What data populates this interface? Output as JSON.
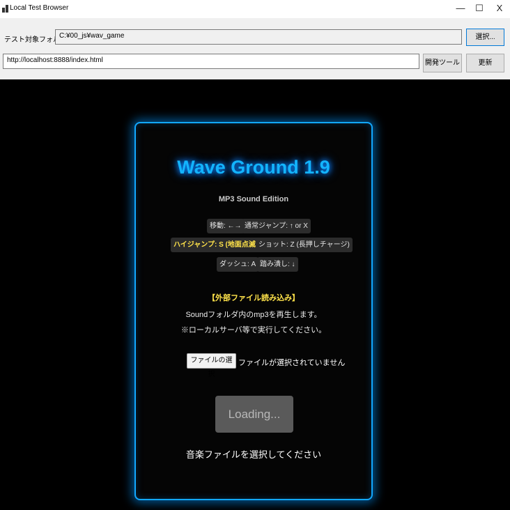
{
  "window": {
    "title": "Local Test Browser",
    "icon": "app-icon",
    "controls": {
      "minimize": "—",
      "maximize": "☐",
      "close": "X"
    }
  },
  "toolbar": {
    "folder_label": "テスト対象フォルダ:",
    "folder_value": "C:¥00_js¥wav_game",
    "select_button": "選択...",
    "url_value": "http://localhost:8888/index.html",
    "devtools_button": "開発ツール",
    "refresh_button": "更新"
  },
  "game": {
    "title": "Wave Ground 1.9",
    "subtitle": "MP3 Sound Edition",
    "controls": [
      {
        "text": "移動: ←→",
        "highlight": false
      },
      {
        "text": "通常ジャンプ: ↑ or X",
        "highlight": false
      },
      {
        "text": "ハイジャンプ: S (地面点滅時)",
        "highlight": true
      },
      {
        "text": "ショット: Z (長押しチャージ)",
        "highlight": false
      },
      {
        "text": "ダッシュ: A",
        "highlight": false
      },
      {
        "text": "踏み潰し: ↓",
        "highlight": false
      }
    ],
    "external": {
      "heading": "【外部ファイル読み込み】",
      "line1": "Soundフォルダ内のmp3を再生します。",
      "line2": "※ローカルサーバ等で実行してください。"
    },
    "file_input": {
      "button": "ファイルの選択",
      "status": "ファイルが選択されていません"
    },
    "start_button": "Loading...",
    "message": "音楽ファイルを選択してください"
  },
  "colors": {
    "accent": "#13b4ff",
    "highlight": "#ffe34a",
    "background": "#000000",
    "toolbar": "#f0f0f0"
  }
}
